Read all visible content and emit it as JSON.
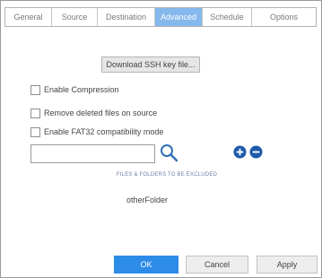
{
  "tabs": [
    {
      "label": "General",
      "active": false
    },
    {
      "label": "Source",
      "active": false
    },
    {
      "label": "Destination",
      "active": false
    },
    {
      "label": "Advanced",
      "active": true
    },
    {
      "label": "Schedule",
      "active": false
    },
    {
      "label": "Options",
      "active": false
    }
  ],
  "advanced": {
    "download_key_label": "Download SSH key file...",
    "options": [
      {
        "label": "Enable Compression",
        "checked": false
      },
      {
        "label": "Remove deleted files on source",
        "checked": false
      },
      {
        "label": "Enable FAT32 compatibility mode",
        "checked": false
      }
    ],
    "search": {
      "value": "",
      "placeholder": ""
    },
    "excluded_caption": "FILES & FOLDERS TO BE EXCLUDED",
    "excluded_items": [
      "otherFolder"
    ]
  },
  "footer": {
    "ok_label": "OK",
    "cancel_label": "Cancel",
    "apply_label": "Apply"
  },
  "icons": {
    "search": "search-icon",
    "add": "plus-circle-icon",
    "remove": "minus-circle-icon"
  },
  "colors": {
    "active_tab": "#85b8ec",
    "primary_button": "#2d8ce8",
    "round_button": "#1d5aa8",
    "caption": "#6b7fa8"
  }
}
